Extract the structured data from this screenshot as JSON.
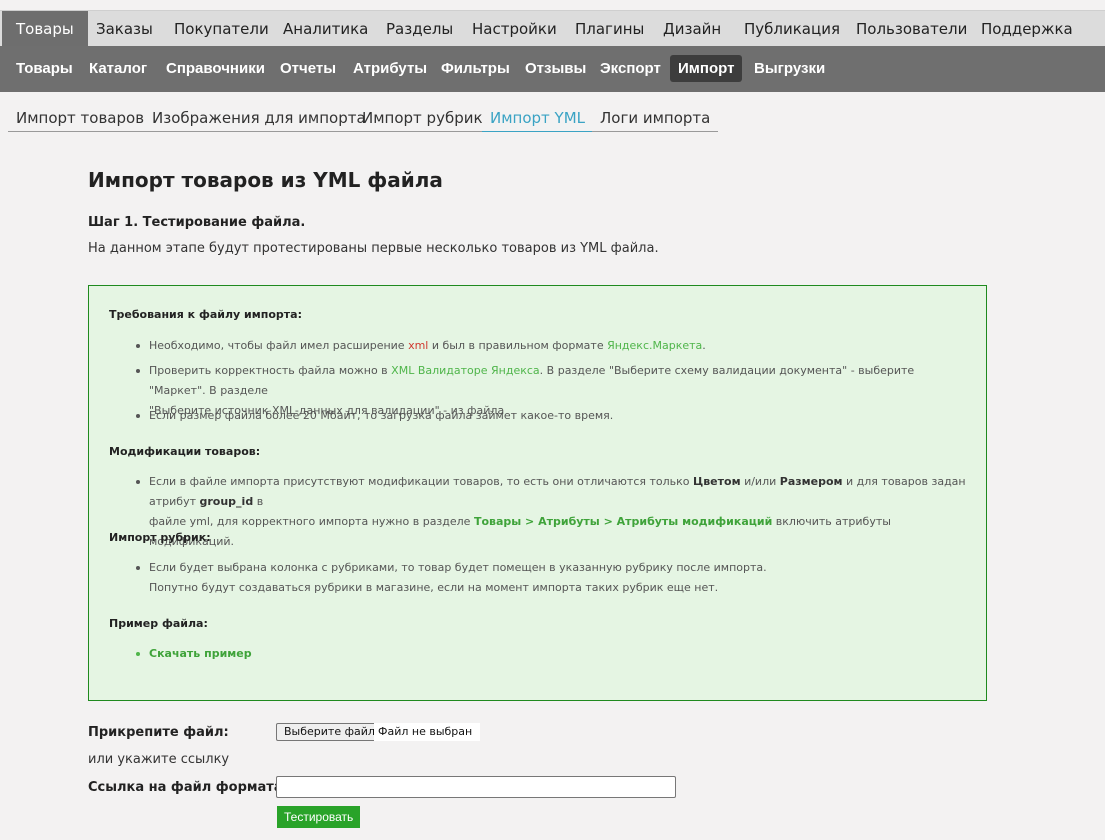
{
  "top_menu": [
    {
      "label": "Товары",
      "active": true
    },
    {
      "label": "Заказы"
    },
    {
      "label": "Покупатели"
    },
    {
      "label": "Аналитика"
    },
    {
      "label": "Разделы"
    },
    {
      "label": "Настройки"
    },
    {
      "label": "Плагины"
    },
    {
      "label": "Дизайн"
    },
    {
      "label": "Публикация"
    },
    {
      "label": "Пользователи"
    },
    {
      "label": "Поддержка"
    }
  ],
  "sub_menu": [
    {
      "label": "Товары"
    },
    {
      "label": "Каталог"
    },
    {
      "label": "Справочники"
    },
    {
      "label": "Отчеты"
    },
    {
      "label": "Атрибуты"
    },
    {
      "label": "Фильтры"
    },
    {
      "label": "Отзывы"
    },
    {
      "label": "Экспорт"
    },
    {
      "label": "Импорт",
      "active": true
    },
    {
      "label": "Выгрузки"
    }
  ],
  "tabs": [
    {
      "label": "Импорт товаров"
    },
    {
      "label": "Изображения для импорта"
    },
    {
      "label": "Импорт рубрик"
    },
    {
      "label": "Импорт YML",
      "active": true
    },
    {
      "label": "Логи импорта"
    }
  ],
  "page": {
    "title": "Импорт товаров из YML файла",
    "step_title": "Шаг 1. Тестирование файла.",
    "step_desc": "На данном этапе будут протестированы первые несколько товаров из YML файла."
  },
  "info": {
    "req_heading": "Требования к файлу импорта:",
    "req_1_a": "Необходимо, чтобы файл имел расширение ",
    "req_1_xml": "xml",
    "req_1_b": " и был в правильном формате ",
    "req_1_link": "Яндекс.Маркета",
    "req_1_c": ".",
    "req_2_a": "Проверить корректность файла можно в ",
    "req_2_link": "XML Валидаторе Яндекса",
    "req_2_b": ". В разделе \"Выберите схему валидации документа\" - выберите \"Маркет\". В разделе",
    "req_2_c": "\"Выберите источник XML-данных для валидации\" - из файла",
    "req_3": "Если размер файла более 20 Мбайт, то загрузка файла займет какое-то время.",
    "mod_heading": "Модификации товаров:",
    "mod_a": "Если в файле импорта присутствуют модификации товаров, то есть они отличаются только ",
    "mod_color": "Цветом",
    "mod_b": " и/или ",
    "mod_size": "Размером",
    "mod_c": " и для товаров задан атрибут ",
    "mod_attr": "group_id",
    "mod_d": " в",
    "mod_e": "файле yml, для корректного импорта нужно в разделе ",
    "mod_link": "Товары > Атрибуты > Атрибуты модификаций",
    "mod_f": " включить атрибуты модификаций.",
    "cat_heading": "Импорт рубрик:",
    "cat_1": "Если будет выбрана колонка с рубриками, то товар будет помещен в указанную рубрику после импорта.",
    "cat_2": "Попутно будут создаваться рубрики в магазине, если на момент импорта таких рубрик еще нет.",
    "ex_heading": "Пример файла:",
    "ex_link": "Скачать пример"
  },
  "form": {
    "attach_label": "Прикрепите файл:",
    "file_button": "Выберите файл",
    "file_status": "Файл не выбран",
    "or_link": "или укажите ссылку",
    "url_label": "Ссылка на файл формата YML:",
    "url_value": "",
    "test_button": "Тестировать"
  }
}
